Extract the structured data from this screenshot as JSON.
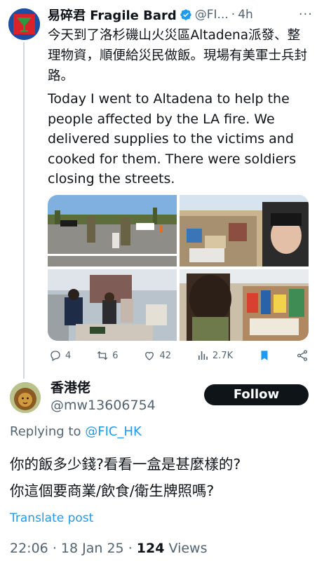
{
  "tweet": {
    "author_name": "易碎君 Fragile Bard",
    "handle": "@FI...",
    "separator": "·",
    "time": "4h",
    "more_icon": "more-icon",
    "text_zh": "今天到了洛杉磯山火災區Altadena派發、整理物資，順便給災民做飯。現場有美軍士兵封路。",
    "text_en": "Today I went to Altadena to help the people affected by the LA fire. We delivered supplies to the victims and cooked for them. There were soldiers closing the streets.",
    "stats": {
      "replies": "4",
      "reposts": "6",
      "likes": "42",
      "views": "2.7K"
    },
    "colors": {
      "accent": "#1d9bf0",
      "text": "#0f1419",
      "muted": "#536471"
    }
  },
  "reply": {
    "author_name": "香港佬",
    "handle": "@mw13606754",
    "follow_label": "Follow",
    "replying_prefix": "Replying to",
    "replying_handle": "@FIC_HK",
    "text_line1": "你的飯多少錢?看看一盒是甚麼樣的?",
    "text_line2": "你這個要商業/飲食/衛生牌照嗎?",
    "translate_label": "Translate post",
    "time": "22:06",
    "sep1": "·",
    "date": "18 Jan 25",
    "sep2": "·",
    "views_count": "124",
    "views_label": "Views"
  }
}
